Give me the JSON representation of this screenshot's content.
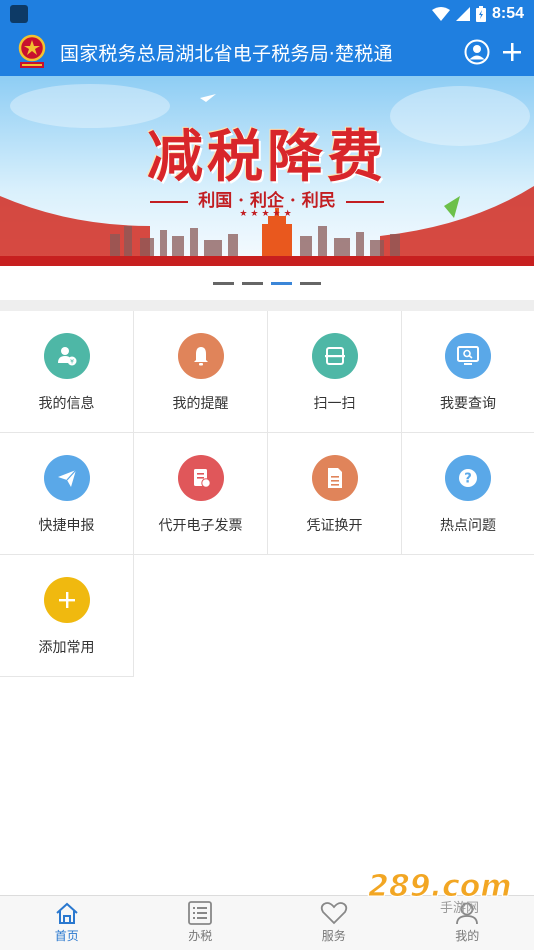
{
  "status_bar": {
    "time": "8:54"
  },
  "header": {
    "title": "国家税务总局湖北省电子税务局·楚税通"
  },
  "banner": {
    "title": "减税降费",
    "subtitle": "利国 · 利企 · 利民",
    "stars": "★★★★★",
    "pages": 4,
    "active_page": 3
  },
  "grid": {
    "items": [
      {
        "label": "我的信息",
        "icon": "user-info-icon",
        "color": "#4eb7a6"
      },
      {
        "label": "我的提醒",
        "icon": "bell-icon",
        "color": "#e0845a"
      },
      {
        "label": "扫一扫",
        "icon": "scan-icon",
        "color": "#4eb7a6"
      },
      {
        "label": "我要查询",
        "icon": "monitor-search-icon",
        "color": "#5aa8e8"
      },
      {
        "label": "快捷申报",
        "icon": "paper-plane-icon",
        "color": "#5aa8e8"
      },
      {
        "label": "代开电子发票",
        "icon": "invoice-icon",
        "color": "#e0575a"
      },
      {
        "label": "凭证换开",
        "icon": "document-icon",
        "color": "#e0845a"
      },
      {
        "label": "热点问题",
        "icon": "question-icon",
        "color": "#5aa8e8"
      },
      {
        "label": "添加常用",
        "icon": "plus-icon",
        "color": "#f0b90f"
      }
    ]
  },
  "tabbar": {
    "tabs": [
      {
        "label": "首页",
        "icon": "home-icon",
        "active": true
      },
      {
        "label": "办税",
        "icon": "list-icon",
        "active": false
      },
      {
        "label": "服务",
        "icon": "heart-icon",
        "active": false
      },
      {
        "label": "我的",
        "icon": "profile-icon",
        "active": false
      }
    ],
    "active_color": "#2a78cf"
  },
  "watermark": {
    "text": "289.com",
    "sub": "手游网"
  }
}
